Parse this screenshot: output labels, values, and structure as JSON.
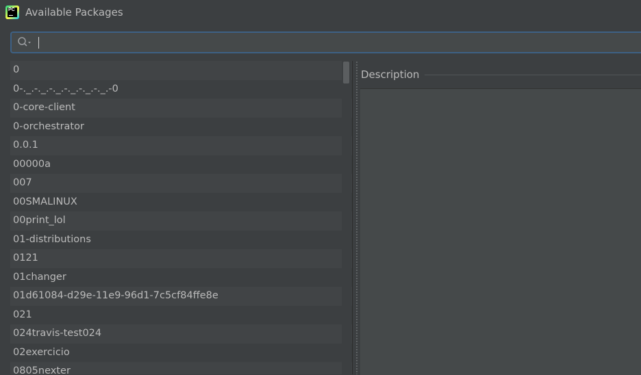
{
  "window": {
    "title": "Available Packages",
    "logo_text": "PC",
    "logo_icon": "pycharm-logo-icon"
  },
  "search": {
    "value": "",
    "placeholder": "",
    "icon": "search-icon"
  },
  "packages": [
    "0",
    "0-._.-._.-._.-._.-._.-._.-0",
    "0-core-client",
    "0-orchestrator",
    "0.0.1",
    "00000a",
    "007",
    "00SMALINUX",
    "00print_lol",
    "01-distributions",
    "0121",
    "01changer",
    "01d61084-d29e-11e9-96d1-7c5cf84ffe8e",
    "021",
    "024travis-test024",
    "02exercicio",
    "0805nexter"
  ],
  "description": {
    "title": "Description",
    "body": ""
  },
  "colors": {
    "background": "#3c3f41",
    "search_border": "#3d6185",
    "row_alt": "#414446",
    "text": "#bbbbbb"
  }
}
